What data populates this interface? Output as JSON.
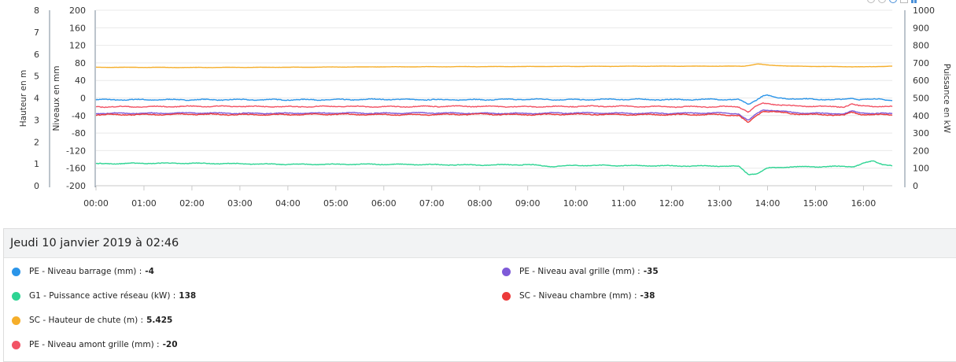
{
  "chart_data": {
    "type": "line",
    "x_ticks": [
      "00:00",
      "01:00",
      "02:00",
      "03:00",
      "04:00",
      "05:00",
      "06:00",
      "07:00",
      "08:00",
      "09:00",
      "10:00",
      "11:00",
      "12:00",
      "13:00",
      "14:00",
      "15:00",
      "16:00"
    ],
    "x_range_hours": [
      0,
      16.6
    ],
    "axes": {
      "hauteur": {
        "title": "Hauteur en m",
        "min": 0,
        "max": 8,
        "ticks": [
          "0",
          "1",
          "2",
          "3",
          "4",
          "5",
          "6",
          "7",
          "8"
        ]
      },
      "niveaux": {
        "title": "Niveaux en mm",
        "min": -200,
        "max": 200,
        "ticks": [
          "-200",
          "-160",
          "-120",
          "-80",
          "-40",
          "0",
          "40",
          "80",
          "120",
          "160",
          "200"
        ]
      },
      "puissance": {
        "title": "Puissance en kW",
        "min": 0,
        "max": 1000,
        "ticks": [
          "0",
          "100",
          "200",
          "300",
          "400",
          "500",
          "600",
          "700",
          "800",
          "900",
          "1000"
        ]
      }
    },
    "grid": "horizontal",
    "series": [
      {
        "name": "PE - Niveau barrage (mm)",
        "axis": "niveaux",
        "color": "#2b95e9",
        "points": [
          [
            0,
            -4
          ],
          [
            1,
            -4
          ],
          [
            2,
            -4
          ],
          [
            3,
            -4
          ],
          [
            4,
            -4
          ],
          [
            5,
            -4
          ],
          [
            6,
            -3
          ],
          [
            7,
            -4
          ],
          [
            8,
            -4
          ],
          [
            9,
            -3
          ],
          [
            10,
            -4
          ],
          [
            11,
            -3
          ],
          [
            12,
            -4
          ],
          [
            13,
            -3
          ],
          [
            13.4,
            -4
          ],
          [
            13.6,
            -15
          ],
          [
            13.75,
            -5
          ],
          [
            13.9,
            5
          ],
          [
            14.0,
            6
          ],
          [
            14.2,
            0
          ],
          [
            14.6,
            -2
          ],
          [
            15,
            -3
          ],
          [
            15.6,
            -4
          ],
          [
            15.75,
            0
          ],
          [
            15.9,
            -3
          ],
          [
            16.3,
            -3
          ],
          [
            16.6,
            -5
          ]
        ]
      },
      {
        "name": "G1 - Puissance active réseau (kW)",
        "axis": "puissance",
        "color": "#2ed493",
        "points": [
          [
            0,
            125
          ],
          [
            1,
            128
          ],
          [
            2,
            128
          ],
          [
            3,
            125
          ],
          [
            4,
            122
          ],
          [
            5,
            122
          ],
          [
            6,
            122
          ],
          [
            7,
            120
          ],
          [
            8,
            118
          ],
          [
            9,
            120
          ],
          [
            9.5,
            110
          ],
          [
            10,
            116
          ],
          [
            11,
            115
          ],
          [
            12,
            113
          ],
          [
            13,
            112
          ],
          [
            13.4,
            110
          ],
          [
            13.6,
            65
          ],
          [
            13.8,
            70
          ],
          [
            14.0,
            100
          ],
          [
            14.5,
            108
          ],
          [
            15.0,
            108
          ],
          [
            15.5,
            110
          ],
          [
            15.8,
            110
          ],
          [
            16.0,
            128
          ],
          [
            16.2,
            140
          ],
          [
            16.4,
            122
          ],
          [
            16.6,
            115
          ]
        ]
      },
      {
        "name": "SC - Hauteur de chute (m)",
        "axis": "hauteur",
        "color": "#f5ae2a",
        "points": [
          [
            0,
            5.4
          ],
          [
            2,
            5.39
          ],
          [
            4,
            5.4
          ],
          [
            6,
            5.42
          ],
          [
            8,
            5.43
          ],
          [
            10,
            5.44
          ],
          [
            12,
            5.45
          ],
          [
            13,
            5.45
          ],
          [
            13.5,
            5.45
          ],
          [
            13.8,
            5.55
          ],
          [
            14.0,
            5.5
          ],
          [
            14.5,
            5.45
          ],
          [
            16.0,
            5.42
          ],
          [
            16.6,
            5.45
          ]
        ]
      },
      {
        "name": "PE - Niveau amont grille (mm)",
        "axis": "niveaux",
        "color": "#f25365",
        "points": [
          [
            0,
            -20
          ],
          [
            1,
            -20
          ],
          [
            2,
            -19
          ],
          [
            3,
            -19
          ],
          [
            4,
            -20
          ],
          [
            5,
            -19
          ],
          [
            6,
            -20
          ],
          [
            7,
            -19
          ],
          [
            8,
            -19
          ],
          [
            9,
            -20
          ],
          [
            10,
            -19
          ],
          [
            11,
            -19
          ],
          [
            12,
            -20
          ],
          [
            13,
            -20
          ],
          [
            13.4,
            -20
          ],
          [
            13.6,
            -32
          ],
          [
            13.75,
            -20
          ],
          [
            13.9,
            -12
          ],
          [
            14.1,
            -14
          ],
          [
            14.5,
            -18
          ],
          [
            15,
            -19
          ],
          [
            15.6,
            -20
          ],
          [
            15.75,
            -14
          ],
          [
            15.9,
            -18
          ],
          [
            16.3,
            -19
          ],
          [
            16.6,
            -20
          ]
        ]
      },
      {
        "name": "PE - Niveau aval grille (mm)",
        "axis": "niveaux",
        "color": "#7e5ad8",
        "points": [
          [
            0,
            -35
          ],
          [
            1,
            -35
          ],
          [
            2,
            -34
          ],
          [
            3,
            -35
          ],
          [
            4,
            -35
          ],
          [
            5,
            -34
          ],
          [
            6,
            -35
          ],
          [
            7,
            -34
          ],
          [
            8,
            -35
          ],
          [
            9,
            -35
          ],
          [
            10,
            -34
          ],
          [
            11,
            -35
          ],
          [
            12,
            -35
          ],
          [
            13,
            -34
          ],
          [
            13.4,
            -36
          ],
          [
            13.6,
            -52
          ],
          [
            13.75,
            -38
          ],
          [
            13.9,
            -27
          ],
          [
            14.1,
            -28
          ],
          [
            14.5,
            -33
          ],
          [
            15,
            -35
          ],
          [
            15.6,
            -36
          ],
          [
            15.75,
            -30
          ],
          [
            15.9,
            -34
          ],
          [
            16.3,
            -35
          ],
          [
            16.6,
            -36
          ]
        ]
      },
      {
        "name": "SC - Niveau chambre (mm)",
        "axis": "niveaux",
        "color": "#ec3a3a",
        "points": [
          [
            0,
            -38
          ],
          [
            1,
            -38
          ],
          [
            2,
            -37
          ],
          [
            3,
            -38
          ],
          [
            4,
            -38
          ],
          [
            5,
            -37
          ],
          [
            6,
            -38
          ],
          [
            7,
            -38
          ],
          [
            8,
            -37
          ],
          [
            9,
            -38
          ],
          [
            10,
            -37
          ],
          [
            11,
            -38
          ],
          [
            12,
            -38
          ],
          [
            13,
            -38
          ],
          [
            13.4,
            -40
          ],
          [
            13.6,
            -57
          ],
          [
            13.75,
            -42
          ],
          [
            13.9,
            -30
          ],
          [
            14.1,
            -31
          ],
          [
            14.5,
            -36
          ],
          [
            15,
            -38
          ],
          [
            15.6,
            -39
          ],
          [
            15.75,
            -33
          ],
          [
            15.9,
            -37
          ],
          [
            16.3,
            -38
          ],
          [
            16.6,
            -39
          ]
        ]
      }
    ]
  },
  "tooltip": {
    "date": "Jeudi 10 janvier 2019 à 02:46",
    "items": [
      {
        "label": "PE - Niveau barrage (mm) :",
        "value": "-4",
        "color": "#2b95e9"
      },
      {
        "label": "G1 - Puissance active réseau (kW) :",
        "value": "138",
        "color": "#2ed493"
      },
      {
        "label": "SC - Hauteur de chute (m) :",
        "value": "5.425",
        "color": "#f5ae2a"
      },
      {
        "label": "PE - Niveau amont grille (mm) :",
        "value": "-20",
        "color": "#f25365"
      },
      {
        "label": "PE - Niveau aval grille (mm) :",
        "value": "-35",
        "color": "#7e5ad8"
      },
      {
        "label": "SC - Niveau chambre (mm) :",
        "value": "-38",
        "color": "#ec3a3a"
      }
    ]
  },
  "toolbar": {
    "icons": [
      "refresh-icon",
      "reset-zoom-icon",
      "zoom-icon",
      "export-icon",
      "bar-chart-icon"
    ]
  }
}
